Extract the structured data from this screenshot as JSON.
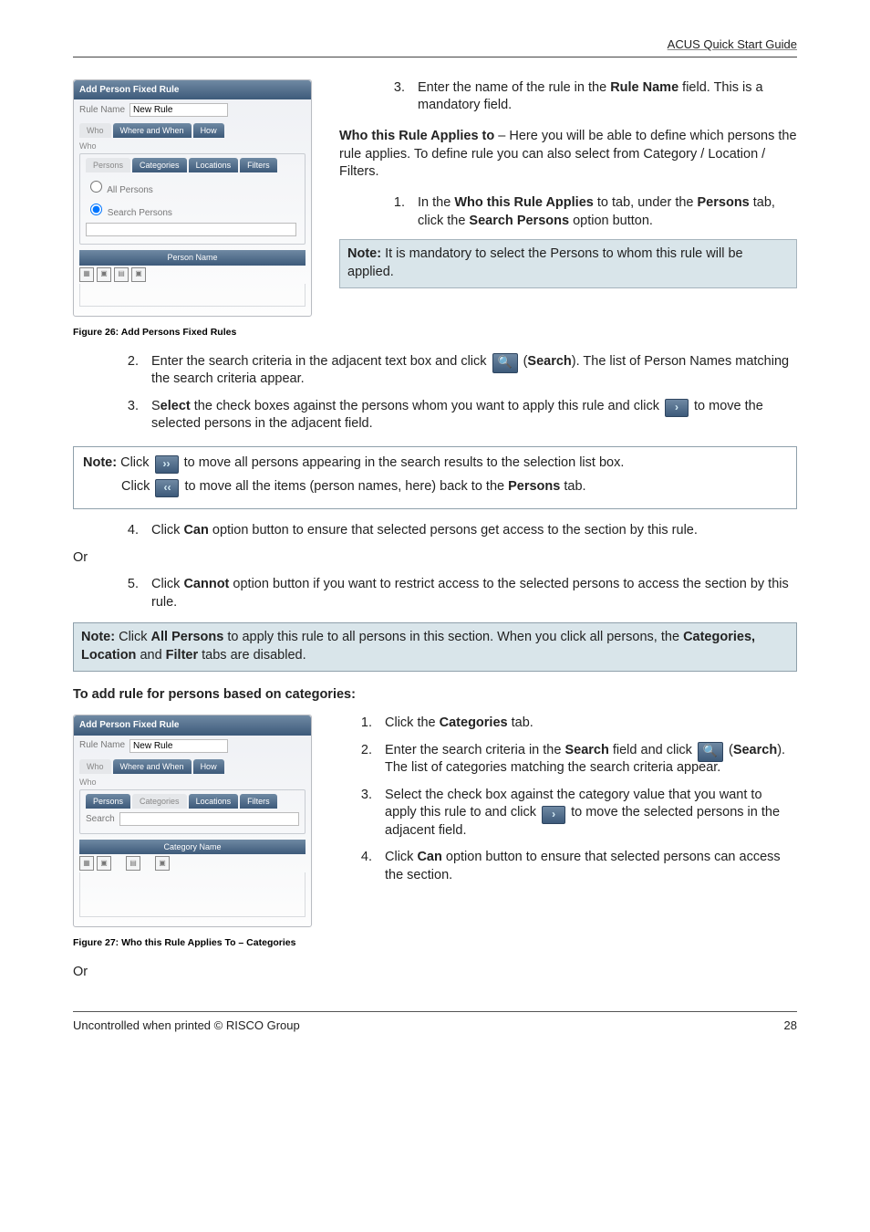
{
  "doc_title": "ACUS Quick Start Guide",
  "panel1": {
    "title": "Add Person Fixed Rule",
    "rule_name_label": "Rule Name",
    "rule_name_value": "New Rule",
    "main_tab_who": "Who",
    "main_tab_where": "Where and When",
    "main_tab_how": "How",
    "group_label": "Who",
    "sub_tabs": {
      "persons": "Persons",
      "categories": "Categories",
      "locations": "Locations",
      "filters": "Filters"
    },
    "opt_all": "All Persons",
    "opt_search": "Search Persons",
    "col_header": "Person Name"
  },
  "step1a_num": "3.",
  "step1a_txt_pre": "Enter the name of the rule in the ",
  "step1a_bold": "Rule Name",
  "step1a_txt_post": " field. This is a mandatory field.",
  "whoapplies_title": "Who this Rule Applies to",
  "whoapplies_txt": " – Here you will be able to define which persons the rule applies. To define rule you can also select from Category / Location / Filters.",
  "step1b_num": "1.",
  "step1b_pre": "In the ",
  "step1b_b1": "Who this Rule Applies",
  "step1b_mid": " to tab, under the ",
  "step1b_b2": "Persons",
  "step1b_mid2": " tab, click the ",
  "step1b_b3": "Search Persons",
  "step1b_post": " option button.",
  "note1_b": "Note:",
  "note1_txt": " It is mandatory to select the Persons to whom this rule will be applied.",
  "fig26": "Figure 26: Add Persons Fixed Rules",
  "s2_num": "2.",
  "s2_pre": "Enter the search criteria in the adjacent text box and click ",
  "s2_paren_open": " (",
  "s2_bold": "Search",
  "s2_post": "). The list of Person Names matching the search criteria appear.",
  "s3_num": "3.",
  "s3_pre": "S",
  "s3_bold1": "elect",
  "s3_mid": " the check boxes against the persons whom you want to apply this rule and click ",
  "s3_post": " to move the selected persons in the adjacent field.",
  "notebox_l1_b": "Note:",
  "notebox_l1_pre": " Click ",
  "notebox_l1_post": " to move all persons appearing in the search results to the selection list box.",
  "notebox_l2_pre": "Click ",
  "notebox_l2_mid": " to move all the items (person names, here) back to the ",
  "notebox_l2_bold": "Persons",
  "notebox_l2_post": " tab.",
  "s4_num": "4.",
  "s4_pre": "Click ",
  "s4_bold": "Can",
  "s4_post": " option button to ensure that selected persons get access to the section by this rule.",
  "or_label": "Or",
  "s5_num": "5.",
  "s5_pre": "Click ",
  "s5_bold": "Cannot",
  "s5_post": " option button if you want to restrict access to the selected persons to access the section by this rule.",
  "note2_b": "Note:",
  "note2_pre": " Click ",
  "note2_b1": "All Persons",
  "note2_mid": " to apply this rule to all persons in this section. When you click all persons, the ",
  "note2_b2": "Categories, Location",
  "note2_mid2": " and ",
  "note2_b3": "Filter",
  "note2_post": " tabs are disabled.",
  "subhead": "To add rule for persons based on categories",
  "panel2_colhdr": "Category Name",
  "panel2_search_label": "Search",
  "c1_num": "1.",
  "c1_pre": "Click the ",
  "c1_bold": "Categories",
  "c1_post": " tab.",
  "c2_num": "2.",
  "c2_pre": "Enter the search criteria in the ",
  "c2_bold1": "Search",
  "c2_mid": " field and click ",
  "c2_open": " (",
  "c2_bold2": "Search",
  "c2_post": "). The list of categories matching the search criteria appear.",
  "c3_num": "3.",
  "c3_pre": "Select the check box against the category value that you want to apply this rule to and click ",
  "c3_post": " to move the selected persons in the adjacent field.",
  "c4_num": "4.",
  "c4_pre": "Click ",
  "c4_bold": "Can",
  "c4_post": " option button to ensure that selected persons can access the section.",
  "fig27": "Figure 27: Who this Rule Applies To – Categories",
  "footer_left": "Uncontrolled when printed © RISCO Group",
  "footer_right": "28",
  "icon_search": "🔍",
  "icon_fwd1": "›",
  "icon_fwd2": "››",
  "icon_back2": "‹‹"
}
